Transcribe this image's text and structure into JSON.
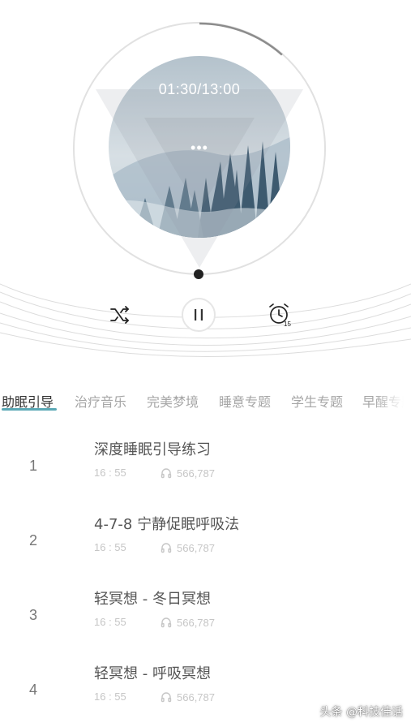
{
  "player": {
    "time": "01:30/13:00",
    "more_label": "•••",
    "progress": 0.115,
    "timer_minutes": "15"
  },
  "tabs": [
    "助眠引导",
    "治疗音乐",
    "完美梦境",
    "睡意专题",
    "学生专题",
    "早醒专题"
  ],
  "active_tab_index": 0,
  "tracks": [
    {
      "num": "1",
      "title": "深度睡眠引导练习",
      "duration": "16 : 55",
      "listens": "566,787"
    },
    {
      "num": "2",
      "title": "4-7-8 宁静促眠呼吸法",
      "duration": "16 : 55",
      "listens": "566,787"
    },
    {
      "num": "3",
      "title": "轻冥想 - 冬日冥想",
      "duration": "16 : 55",
      "listens": "566,787"
    },
    {
      "num": "4",
      "title": "轻冥想 - 呼吸冥想",
      "duration": "16 : 55",
      "listens": "566,787"
    }
  ],
  "watermark": "头条 @科技佳话",
  "colors": {
    "accent": "#5aa8b5",
    "progress": "#8c8c8c",
    "knob": "#222222",
    "muted_text": "#c6c6c6"
  },
  "icons": [
    "shuffle-icon",
    "pause-icon",
    "alarm-timer-icon",
    "headphones-icon",
    "more-dots-icon"
  ]
}
